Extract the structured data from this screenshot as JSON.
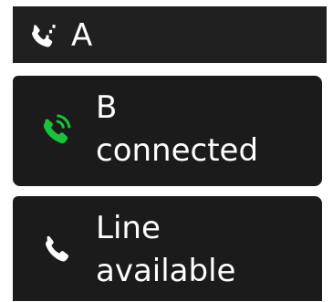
{
  "lines": [
    {
      "label": "A",
      "icon": "phone-forwarding-icon",
      "icon_color": "#ffffff"
    },
    {
      "label": "B",
      "status": "connected",
      "icon": "phone-in-talk-icon",
      "icon_color": "#19c13c"
    },
    {
      "label": "Line",
      "status": "available",
      "icon": "phone-icon",
      "icon_color": "#ffffff"
    }
  ],
  "colors": {
    "tile_background": "#1b1b1b",
    "page_background": "#ffffff",
    "connected_accent": "#19c13c"
  }
}
